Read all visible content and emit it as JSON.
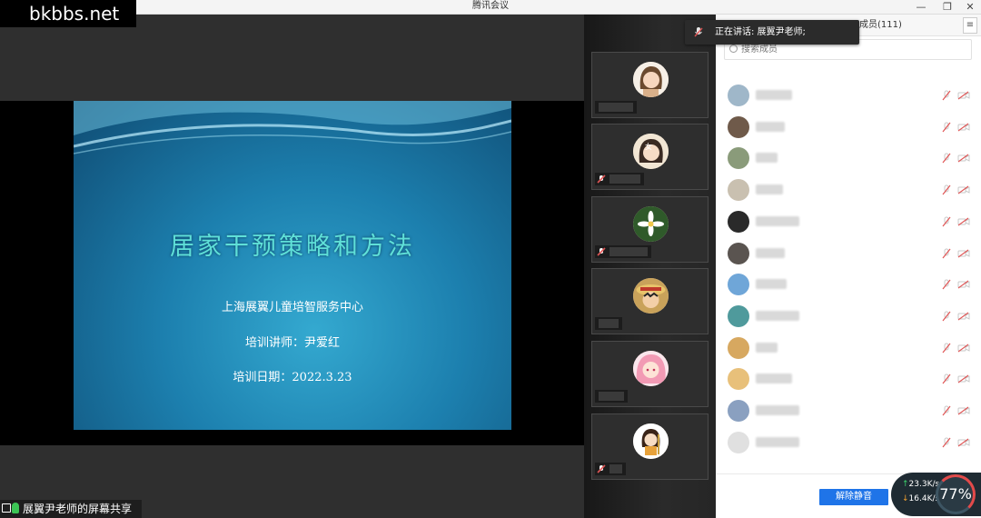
{
  "window": {
    "title": "腾讯会议",
    "minimize": "—",
    "restore": "❐",
    "close": "✕"
  },
  "watermark": "bkbbs.net",
  "slide": {
    "title": "居家干预策略和方法",
    "org": "上海展翼儿童培智服务中心",
    "lecturer": "培训讲师：尹爱红",
    "date": "培训日期：2022.3.23"
  },
  "share_indicator": "展翼尹老师的屏幕共享",
  "toast": "正在讲话: 展翼尹老师;",
  "panel": {
    "header": "成员(111)",
    "menu_icon": "≡",
    "search_placeholder": "搜索成员",
    "unmute_all": "解除静音"
  },
  "video_tiles": [
    {
      "avatar": "cartoon-girl",
      "muted": false
    },
    {
      "avatar": "cartoon-girl-2",
      "muted": true
    },
    {
      "avatar": "white-flower",
      "muted": true
    },
    {
      "avatar": "luffy",
      "muted": false
    },
    {
      "avatar": "pink-hair-anime",
      "muted": false
    },
    {
      "avatar": "cartoon-doll",
      "muted": true
    }
  ],
  "members": [
    {
      "avatar_color": "#9fb7c9"
    },
    {
      "avatar_color": "#6f5a4a"
    },
    {
      "avatar_color": "#8a9b7a"
    },
    {
      "avatar_color": "#c9c0b0"
    },
    {
      "avatar_color": "#2a2a2a"
    },
    {
      "avatar_color": "#5a5450"
    },
    {
      "avatar_color": "#6fa6d8"
    },
    {
      "avatar_color": "#4f9a9c"
    },
    {
      "avatar_color": "#d7a860"
    },
    {
      "avatar_color": "#e8c07a"
    },
    {
      "avatar_color": "#8aa0c0"
    },
    {
      "avatar_color": "#e0e0e0"
    }
  ],
  "network": {
    "up": "23.3K/s",
    "down": "16.4K/s",
    "cpu": "77%"
  },
  "colors": {
    "accent": "#1f74e8",
    "muted_red": "#e05555"
  }
}
